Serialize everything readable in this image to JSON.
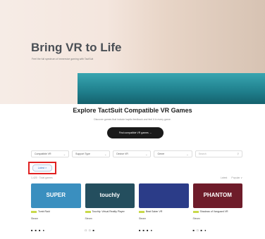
{
  "hero": {
    "title": "Bring VR to Life",
    "subtitle": "Feel the full spectrum of immersive gaming with TactSuit"
  },
  "section": {
    "title": "Explore TactSuit Compatible VR Games",
    "subtitle": "Discover games that include haptic feedback and feel it in every game.",
    "cta_label": "Find compatible VR games →"
  },
  "filters": [
    {
      "label": "Compatible VR"
    },
    {
      "label": "Support Type"
    },
    {
      "label": "Device VR"
    },
    {
      "label": "Genre"
    }
  ],
  "search": {
    "placeholder": "Search"
  },
  "active_chip": {
    "label": "Latest ×"
  },
  "results": {
    "count": "1,420 · Total games",
    "sort_left": "Latest",
    "sort_right": "Popular ∨"
  },
  "games": [
    {
      "name": "Tomb Raid",
      "platform": "Steam",
      "thumb_text": "SUPER",
      "thumb_color": "#3a8fbf",
      "icons": "■ ■ ■ ●"
    },
    {
      "name": "Touchly: Virtual Reality Player",
      "platform": "Steam",
      "thumb_text": "touchly",
      "thumb_color": "#244e5e",
      "icons": "□ □ ■"
    },
    {
      "name": "Beat Saber VR",
      "platform": "Steam",
      "thumb_text": "",
      "thumb_color": "#2b3c88",
      "icons": "■ ■ ■ ●"
    },
    {
      "name": "Shadows of Vanguard VR",
      "platform": "Steam",
      "thumb_text": "PHANTOM",
      "thumb_color": "#6e1c2a",
      "icons": "■ □ ■ ●"
    }
  ]
}
